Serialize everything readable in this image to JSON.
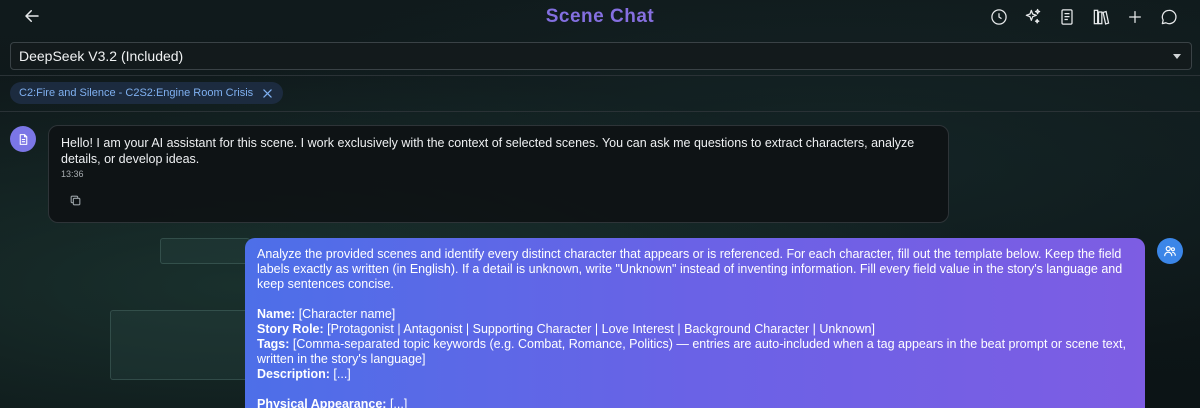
{
  "header": {
    "title": "Scene Chat",
    "back_icon": "arrow-left-icon",
    "tools": [
      {
        "name": "history-icon"
      },
      {
        "name": "sparkles-icon"
      },
      {
        "name": "document-icon"
      },
      {
        "name": "library-icon"
      },
      {
        "name": "plus-icon"
      },
      {
        "name": "chat-bubble-icon"
      }
    ]
  },
  "model": {
    "selected": "DeepSeek V3.2 (Included)"
  },
  "scene_chip": {
    "label": "C2:Fire and Silence - C2S2:Engine Room Crisis"
  },
  "messages": {
    "ai": {
      "text": "Hello! I am your AI assistant for this scene. I work exclusively with the context of selected scenes. You can ask me questions to extract characters, analyze details, or develop ideas.",
      "time": "13:36"
    },
    "user": {
      "intro": "Analyze the provided scenes and identify every distinct character that appears or is referenced. For each character, fill out the template below. Keep the field labels exactly as written (in English). If a detail is unknown, write \"Unknown\" instead of inventing information. Fill every field value in the story's language and keep sentences concise.",
      "fields": [
        {
          "label": "Name:",
          "value": " [Character name]"
        },
        {
          "label": "Story Role:",
          "value": " [Protagonist | Antagonist | Supporting Character | Love Interest | Background Character | Unknown]"
        },
        {
          "label": "Tags:",
          "value": " [Comma-separated topic keywords (e.g. Combat, Romance, Politics) — entries are auto-included when a tag appears in the beat prompt or scene text, written in the story's language]"
        },
        {
          "label": "Description:",
          "value": " [...]"
        }
      ],
      "field_after": {
        "label": "Physical Appearance:",
        "value": " [...]"
      }
    }
  },
  "colors": {
    "accent": "#7b76e6",
    "user_avatar": "#3b86e8",
    "bubble_start": "#4d6fe8",
    "bubble_end": "#7d5de3",
    "chip_bg": "#1c2b3f",
    "chip_text": "#7fb0f0"
  }
}
